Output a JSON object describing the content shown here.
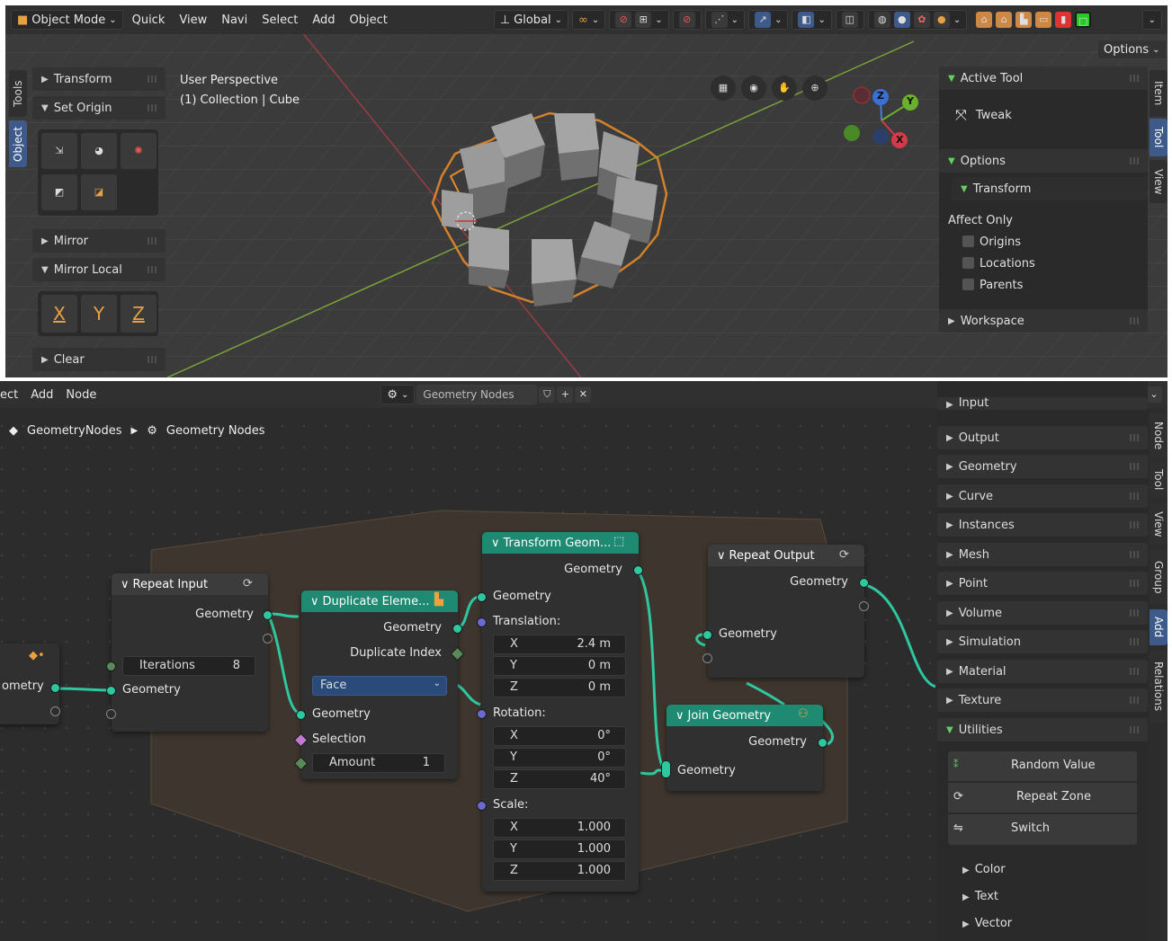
{
  "viewport": {
    "header": {
      "mode": "Object Mode",
      "menus": [
        "Quick",
        "View",
        "Navi",
        "Select",
        "Add",
        "Object"
      ],
      "orientation": "Global",
      "options_label": "Options"
    },
    "overlay_text": {
      "perspective": "User Perspective",
      "collection": "(1) Collection | Cube"
    },
    "left_tabs": [
      "Tools",
      "Object"
    ],
    "left_panels": {
      "transform": "Transform",
      "set_origin": "Set Origin",
      "mirror": "Mirror",
      "mirror_local": "Mirror Local",
      "axes": [
        "X",
        "Y",
        "Z"
      ],
      "clear": "Clear"
    },
    "gizmo_axes": {
      "x": "X",
      "y": "Y",
      "z": "Z"
    },
    "right_panel": {
      "active_tool": "Active Tool",
      "tool_name": "Tweak",
      "options": "Options",
      "transform": "Transform",
      "affect_only": "Affect Only",
      "checkboxes": [
        "Origins",
        "Locations",
        "Parents"
      ],
      "workspace": "Workspace"
    },
    "right_tabs": [
      "Item",
      "Tool",
      "View"
    ]
  },
  "node_editor": {
    "header": {
      "menus": [
        "ect",
        "Add",
        "Node"
      ],
      "tree_name": "Geometry Nodes"
    },
    "breadcrumb": {
      "root": "GeometryNodes",
      "tree": "Geometry Nodes"
    },
    "nodes": {
      "left_partial": {
        "output": "ometry"
      },
      "repeat_input": {
        "title": "Repeat Input",
        "out_geometry": "Geometry",
        "iterations_label": "Iterations",
        "iterations_value": "8",
        "in_geometry": "Geometry"
      },
      "duplicate": {
        "title": "Duplicate Eleme...",
        "out_geometry": "Geometry",
        "out_index": "Duplicate Index",
        "domain": "Face",
        "in_geometry": "Geometry",
        "selection": "Selection",
        "amount_label": "Amount",
        "amount_value": "1"
      },
      "transform": {
        "title": "Transform Geom...",
        "out_geometry": "Geometry",
        "in_geometry": "Geometry",
        "translation": "Translation:",
        "translation_values": [
          {
            "axis": "X",
            "value": "2.4 m"
          },
          {
            "axis": "Y",
            "value": "0 m"
          },
          {
            "axis": "Z",
            "value": "0 m"
          }
        ],
        "rotation": "Rotation:",
        "rotation_values": [
          {
            "axis": "X",
            "value": "0°"
          },
          {
            "axis": "Y",
            "value": "0°"
          },
          {
            "axis": "Z",
            "value": "40°"
          }
        ],
        "scale": "Scale:",
        "scale_values": [
          {
            "axis": "X",
            "value": "1.000"
          },
          {
            "axis": "Y",
            "value": "1.000"
          },
          {
            "axis": "Z",
            "value": "1.000"
          }
        ]
      },
      "repeat_output": {
        "title": "Repeat Output",
        "out_geometry": "Geometry",
        "in_geometry": "Geometry"
      },
      "join": {
        "title": "Join Geometry",
        "out_geometry": "Geometry",
        "in_geometry": "Geometry"
      }
    },
    "sidebar": {
      "partial_top": "Input",
      "categories": [
        "Output",
        "Geometry",
        "Curve",
        "Instances",
        "Mesh",
        "Point",
        "Volume",
        "Simulation",
        "Material",
        "Texture"
      ],
      "utilities": "Utilities",
      "utility_items": [
        "Random Value",
        "Repeat Zone",
        "Switch"
      ],
      "sub_categories": [
        "Color",
        "Text",
        "Vector"
      ]
    },
    "right_tabs": [
      "Node",
      "Tool",
      "View",
      "Group",
      "Add",
      "Relations"
    ]
  }
}
